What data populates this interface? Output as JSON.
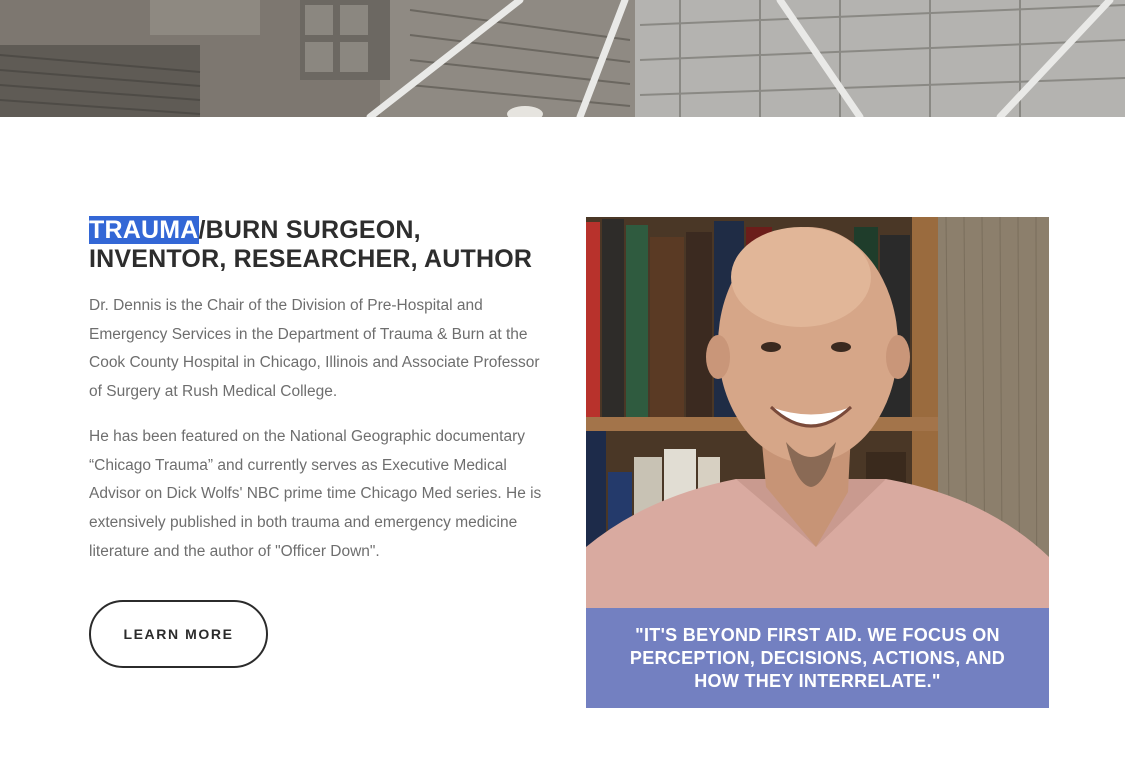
{
  "section": {
    "headline_highlight": "TRAUMA",
    "headline_rest": "/BURN SURGEON, INVENTOR, RESEARCHER, AUTHOR",
    "paragraph_1": "Dr. Dennis is the Chair of the Division of Pre-Hospital and Emergency Services in the Department of Trauma & Burn at the Cook County Hospital in Chicago, Illinois and Associate Professor of Surgery at Rush Medical College.",
    "paragraph_2": "He has been featured on the National Geographic documentary “Chicago Trauma” and currently serves as Executive Medical Advisor on Dick Wolfs' NBC prime time Chicago Med series. He is extensively published in both trauma and emergency medicine literature and the author of \"Officer Down\".",
    "learn_more_label": "LEARN MORE"
  },
  "photo": {
    "quote": "\"IT'S BEYOND FIRST AID. WE FOCUS ON PERCEPTION, DECISIONS, ACTIONS, AND HOW THEY INTERRELATE.\""
  },
  "colors": {
    "headline": "#2d2d2d",
    "body_text": "#6e6e6e",
    "highlight": "#3367d6",
    "quote_band": "#6a7dc4",
    "button_border": "#2b2b2b"
  }
}
